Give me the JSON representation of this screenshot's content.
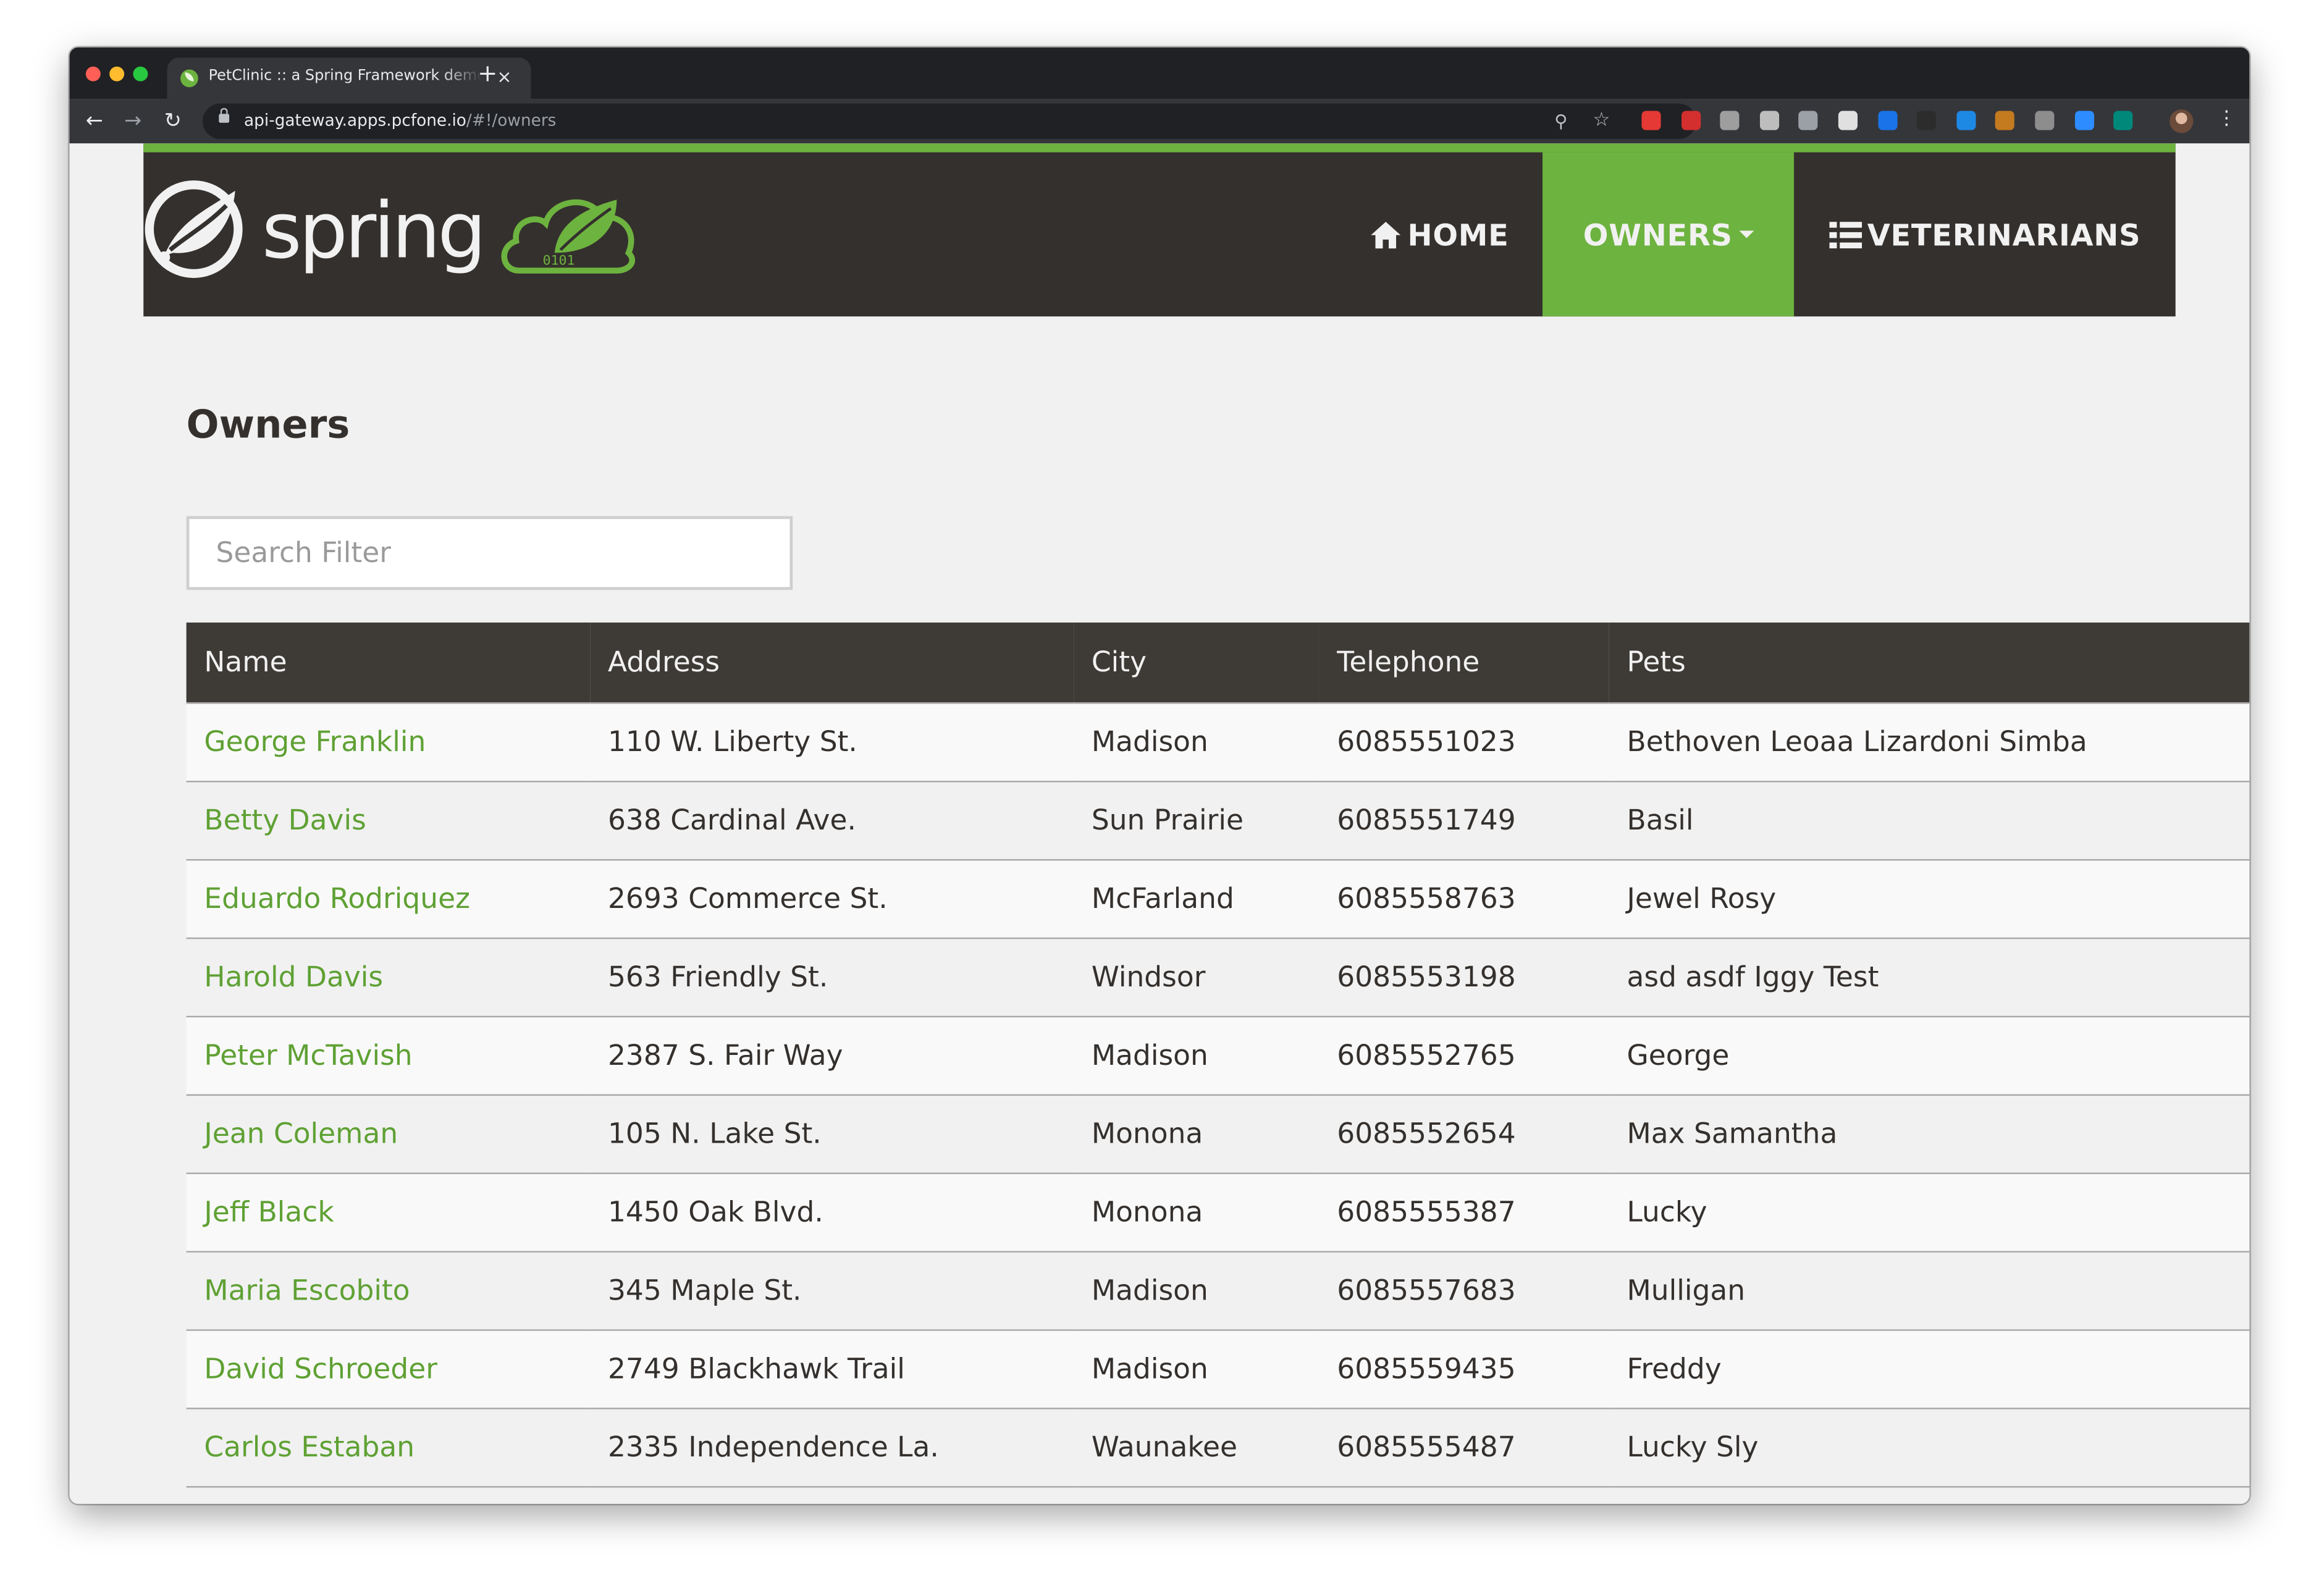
{
  "browser": {
    "tab_title": "PetClinic :: a Spring Framework demonstration",
    "tab_close": "×",
    "new_tab": "+",
    "url_host": "api-gateway.apps.pcfone.io",
    "url_path": "/#!/owners",
    "icons": [
      "back-arrow-icon",
      "forward-arrow-icon",
      "reload-icon",
      "lock-icon",
      "zoom-icon",
      "star-icon",
      "menu-dots-icon"
    ],
    "extension_colors": [
      "#e53935",
      "#d32f2f",
      "#9e9e9e",
      "#bdbdbd",
      "#9aa0a6",
      "#e0e0e0",
      "#1a73e8",
      "#2c2c2c",
      "#1e88e5",
      "#c47a1e",
      "#8d8d8d",
      "#2d8cff",
      "#00897b"
    ]
  },
  "navbar": {
    "brand": "spring",
    "home_label": "HOME",
    "owners_label": "OWNERS",
    "vets_label": "VETERINARIANS",
    "accent_color": "#6db33f",
    "bar_color": "#34302d"
  },
  "main": {
    "heading": "Owners",
    "search": {
      "placeholder": "Search Filter",
      "value": ""
    },
    "table": {
      "columns": [
        "Name",
        "Address",
        "City",
        "Telephone",
        "Pets"
      ],
      "rows": [
        {
          "name": "George Franklin",
          "address": "110 W. Liberty St.",
          "city": "Madison",
          "telephone": "6085551023",
          "pets": "Bethoven Leoaa Lizardoni Simba"
        },
        {
          "name": "Betty Davis",
          "address": "638 Cardinal Ave.",
          "city": "Sun Prairie",
          "telephone": "6085551749",
          "pets": "Basil"
        },
        {
          "name": "Eduardo Rodriquez",
          "address": "2693 Commerce St.",
          "city": "McFarland",
          "telephone": "6085558763",
          "pets": "Jewel Rosy"
        },
        {
          "name": "Harold Davis",
          "address": "563 Friendly St.",
          "city": "Windsor",
          "telephone": "6085553198",
          "pets": "asd asdf Iggy Test"
        },
        {
          "name": "Peter McTavish",
          "address": "2387 S. Fair Way",
          "city": "Madison",
          "telephone": "6085552765",
          "pets": "George"
        },
        {
          "name": "Jean Coleman",
          "address": "105 N. Lake St.",
          "city": "Monona",
          "telephone": "6085552654",
          "pets": "Max Samantha"
        },
        {
          "name": "Jeff Black",
          "address": "1450 Oak Blvd.",
          "city": "Monona",
          "telephone": "6085555387",
          "pets": "Lucky"
        },
        {
          "name": "Maria Escobito",
          "address": "345 Maple St.",
          "city": "Madison",
          "telephone": "6085557683",
          "pets": "Mulligan"
        },
        {
          "name": "David Schroeder",
          "address": "2749 Blackhawk Trail",
          "city": "Madison",
          "telephone": "6085559435",
          "pets": "Freddy"
        },
        {
          "name": "Carlos Estaban",
          "address": "2335 Independence La.",
          "city": "Waunakee",
          "telephone": "6085555487",
          "pets": "Lucky Sly"
        }
      ]
    }
  }
}
